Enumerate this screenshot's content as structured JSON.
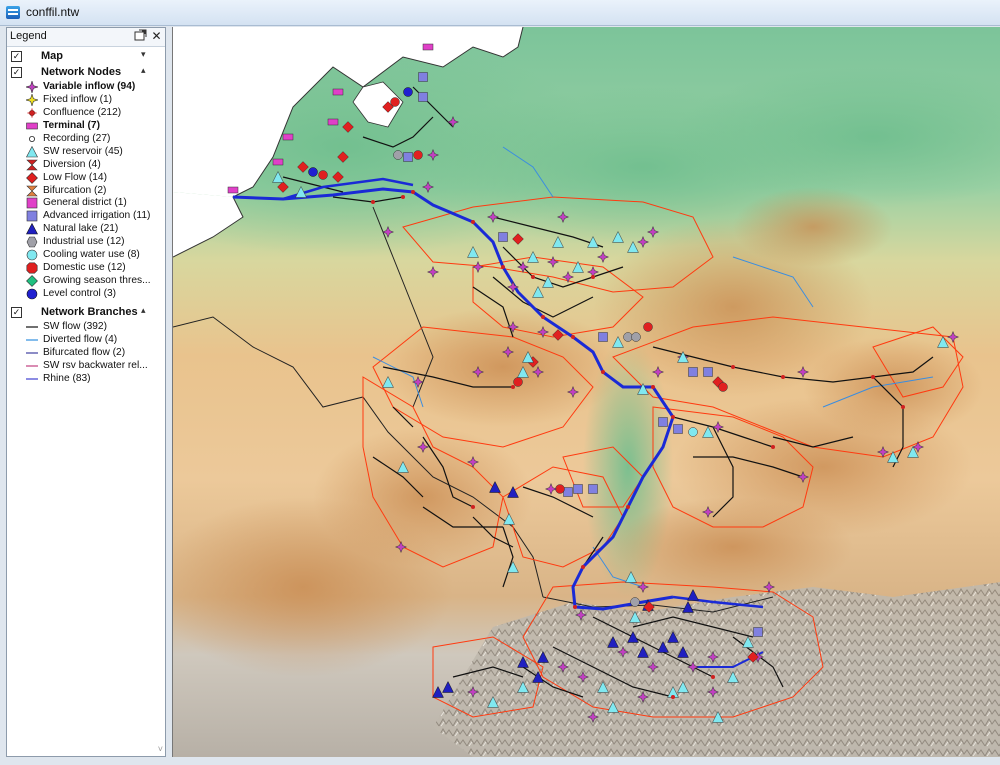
{
  "window": {
    "title": "conffil.ntw"
  },
  "legend": {
    "title": "Legend",
    "close_symbol": "✕",
    "groups": [
      {
        "label": "Map",
        "checked": true,
        "items": []
      },
      {
        "label": "Network Nodes",
        "checked": true,
        "items": [
          {
            "label": "Variable inflow (94)",
            "icon": "variable-inflow-icon",
            "bold": true,
            "color": "#c040c0"
          },
          {
            "label": "Fixed inflow (1)",
            "icon": "fixed-inflow-icon",
            "bold": false,
            "color": "#f0e020"
          },
          {
            "label": "Confluence (212)",
            "icon": "confluence-icon",
            "bold": false,
            "color": "#d02020"
          },
          {
            "label": "Terminal (7)",
            "icon": "terminal-icon",
            "bold": true,
            "color": "#e040c8"
          },
          {
            "label": "Recording (27)",
            "icon": "recording-icon",
            "bold": false,
            "color": "#ffffff"
          },
          {
            "label": "SW reservoir (45)",
            "icon": "sw-reservoir-icon",
            "bold": false,
            "color": "#80e8f0"
          },
          {
            "label": "Diversion (4)",
            "icon": "diversion-icon",
            "bold": false,
            "color": "#d02020"
          },
          {
            "label": "Low Flow (14)",
            "icon": "low-flow-icon",
            "bold": false,
            "color": "#e02020"
          },
          {
            "label": "Bifurcation (2)",
            "icon": "bifurcation-icon",
            "bold": false,
            "color": "#e08040"
          },
          {
            "label": "General district (1)",
            "icon": "general-district-icon",
            "bold": false,
            "color": "#e040c8"
          },
          {
            "label": "Advanced irrigation (11)",
            "icon": "advanced-irrigation-icon",
            "bold": false,
            "color": "#8080e0"
          },
          {
            "label": "Natural lake (21)",
            "icon": "natural-lake-icon",
            "bold": false,
            "color": "#2020c0"
          },
          {
            "label": "Industrial use (12)",
            "icon": "industrial-use-icon",
            "bold": false,
            "color": "#a0a0a8"
          },
          {
            "label": "Cooling water use (8)",
            "icon": "cooling-water-use-icon",
            "bold": false,
            "color": "#80e8f0"
          },
          {
            "label": "Domestic use (12)",
            "icon": "domestic-use-icon",
            "bold": false,
            "color": "#e02020"
          },
          {
            "label": "Growing season thres...",
            "icon": "growing-season-threshold-icon",
            "bold": false,
            "color": "#20c080"
          },
          {
            "label": "Level control (3)",
            "icon": "level-control-icon",
            "bold": false,
            "color": "#2020d0"
          }
        ]
      },
      {
        "label": "Network Branches",
        "checked": true,
        "items": [
          {
            "label": "SW flow (392)",
            "icon": "sw-flow-line-icon",
            "bold": false,
            "color": "#111111"
          },
          {
            "label": "Diverted flow (4)",
            "icon": "diverted-flow-line-icon",
            "bold": false,
            "color": "#3090e0"
          },
          {
            "label": "Bifurcated flow (2)",
            "icon": "bifurcated-flow-line-icon",
            "bold": false,
            "color": "#4040a0"
          },
          {
            "label": "SW rsv backwater rel...",
            "icon": "sw-rsv-backwater-line-icon",
            "bold": false,
            "color": "#c04080"
          },
          {
            "label": "Rhine (83)",
            "icon": "rhine-line-icon",
            "bold": false,
            "color": "#4040d0"
          }
        ]
      }
    ]
  },
  "map": {
    "colors": {
      "sea": "#ffffff",
      "lowland": "#8ccfa0",
      "upland": "#e8c89a",
      "alps": "#c7c0b5",
      "basin_border": "#ff3a10",
      "main_river": "#1a2ad6",
      "tributary": "#111111",
      "country_border": "#222222",
      "water": "#3a8de0"
    }
  }
}
